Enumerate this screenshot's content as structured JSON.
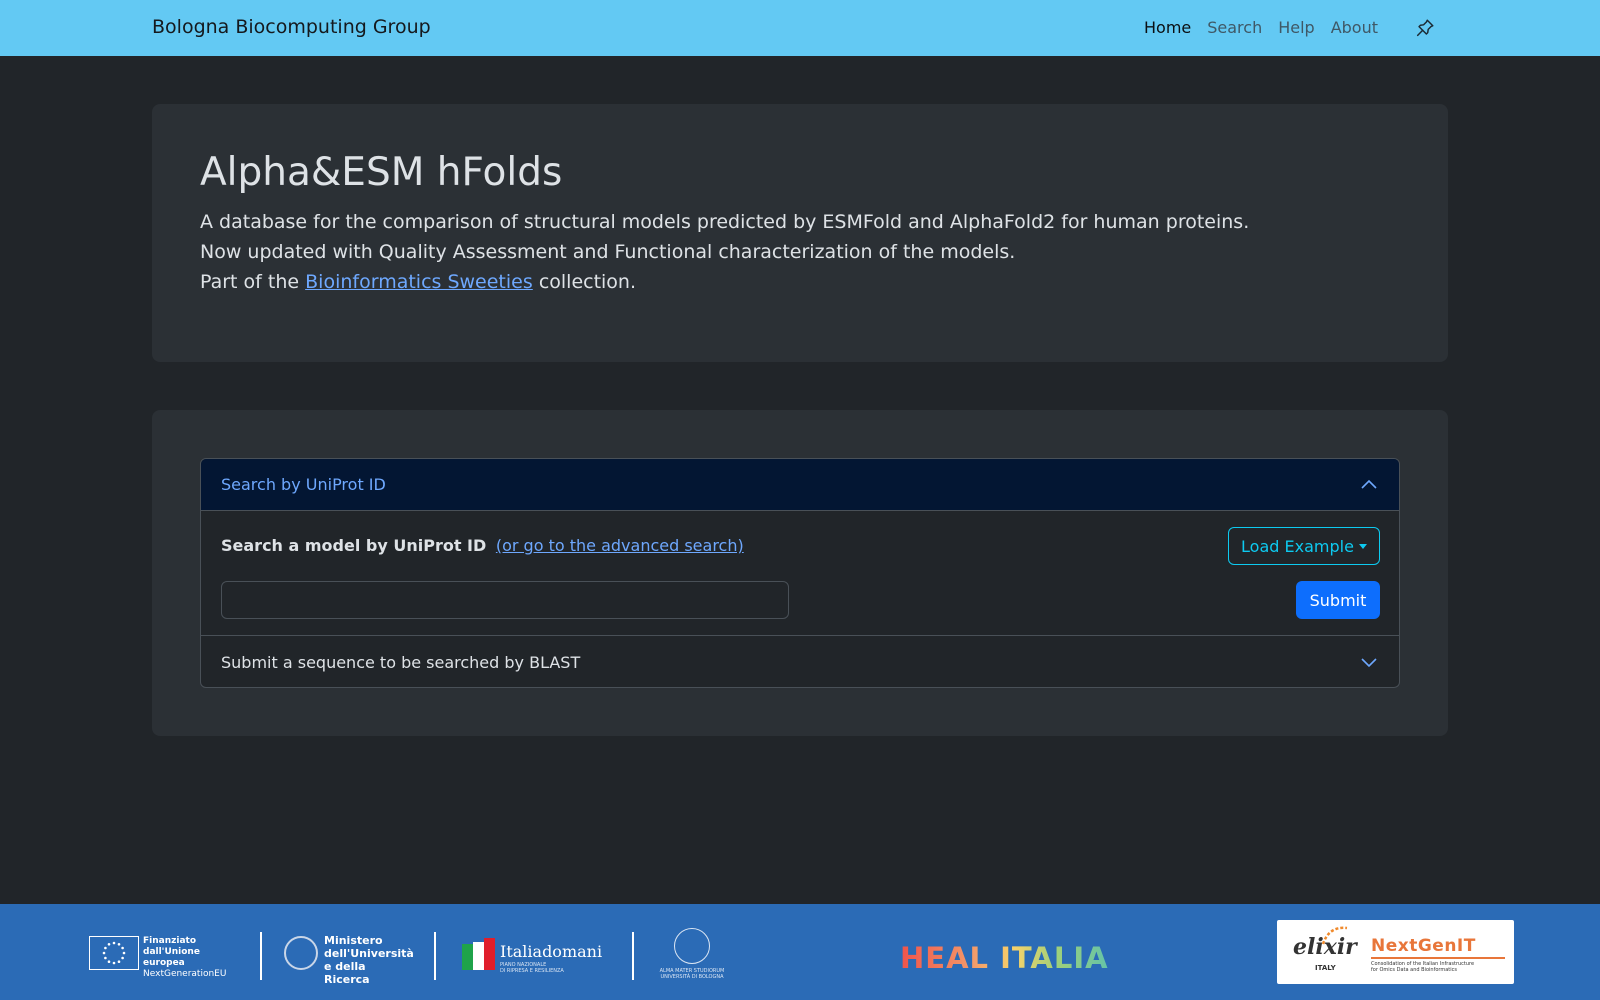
{
  "navbar": {
    "brand": "Bologna Biocomputing Group",
    "links": [
      {
        "label": "Home",
        "active": true
      },
      {
        "label": "Search",
        "active": false
      },
      {
        "label": "Help",
        "active": false
      },
      {
        "label": "About",
        "active": false
      }
    ],
    "pin_icon": "pin-icon"
  },
  "hero": {
    "title": "Alpha&ESM hFolds",
    "line1": "A database for the comparison of structural models predicted by ESMFold and AlphaFold2 for human proteins.",
    "line2": "Now updated with Quality Assessment and Functional characterization of the models.",
    "line3_prefix": "Part of the",
    "line3_link": "Bioinformatics Sweeties",
    "line3_suffix": "collection."
  },
  "search": {
    "uniprot_header": "Search by UniProt ID",
    "body_label": "Search a model by UniProt ID",
    "advanced_link": "(or go to the advanced search)",
    "load_example": "Load Example",
    "input_value": "",
    "input_placeholder": "",
    "submit": "Submit",
    "blast_header": "Submit a sequence to be searched by BLAST"
  },
  "footer": {
    "eu": {
      "line1": "Finanziato",
      "line2": "dall'Unione europea",
      "line3": "NextGenerationEU"
    },
    "mur": {
      "line1": "Ministero",
      "line2": "dell'Università",
      "line3": "e della Ricerca"
    },
    "italia": {
      "name": "Italiadomani",
      "sub1": "PIANO NAZIONALE",
      "sub2": "DI RIPRESA E RESILIENZA"
    },
    "unibo": {
      "line1": "ALMA MATER STUDIORUM",
      "line2": "UNIVERSITÀ DI BOLOGNA"
    },
    "heal": "HEAL ITALIA",
    "elixir": {
      "word": "elixir",
      "country": "ITALY"
    },
    "nextgenit": {
      "word": "NextGenIT",
      "sub1": "Consolidation of the Italian Infrastructure",
      "sub2": "for Omics Data and Bioinformatics"
    }
  },
  "colors": {
    "navbar_bg": "#63c9f3",
    "page_bg": "#212529",
    "panel_bg": "#2b3035",
    "accent_link": "#6ea8fe",
    "active_header_bg": "#031633",
    "info_outline": "#0dcaf0",
    "primary_button": "#0d6efd",
    "footer_bg": "#2b6bb6"
  }
}
